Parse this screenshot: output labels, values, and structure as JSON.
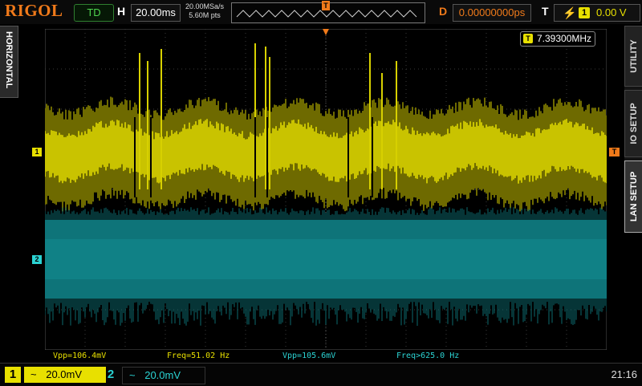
{
  "topbar": {
    "brand": "RIGOL",
    "run_status": "TD",
    "horizontal_label": "H",
    "timebase": "20.00ms",
    "sample_rate": "20.00MSa/s",
    "memory_depth": "5.60M pts",
    "trigger_position_marker": "T",
    "delay_label": "D",
    "delay_value": "0.00000000ps",
    "trigger_label": "T",
    "trigger_source": "1",
    "trigger_level": "0.00 V"
  },
  "left_tab": {
    "label": "HORIZONTAL"
  },
  "right_tabs": [
    {
      "label": "UTILITY"
    },
    {
      "label": "IO SETUP"
    },
    {
      "label": "LAN SETUP"
    }
  ],
  "display": {
    "freq_counter_marker": "T",
    "freq_counter_value": "7.39300MHz",
    "ch1_marker": "1",
    "ch2_marker": "2",
    "trigger_level_marker": "T"
  },
  "measurements": [
    {
      "text": "Vpp=106.4mV",
      "color": "#e8e000"
    },
    {
      "text": "Freq=51.02 Hz",
      "color": "#e8e000"
    },
    {
      "text": "Vpp=105.6mV",
      "color": "#2bd3d3"
    },
    {
      "text": "Freq>625.0 Hz",
      "color": "#2bd3d3"
    }
  ],
  "channels": [
    {
      "number": "1",
      "coupling": "~",
      "scale": "20.0mV",
      "color": "#e8e000",
      "active": true
    },
    {
      "number": "2",
      "coupling": "~",
      "scale": "20.0mV",
      "color": "#2bd3d3",
      "active": false
    }
  ],
  "clock": "21:16",
  "colors": {
    "brand": "#f07a1a",
    "ch1": "#e8e000",
    "ch2": "#2bd3d3",
    "trigger": "#f07a1a",
    "run_status": "#4fd34f"
  }
}
